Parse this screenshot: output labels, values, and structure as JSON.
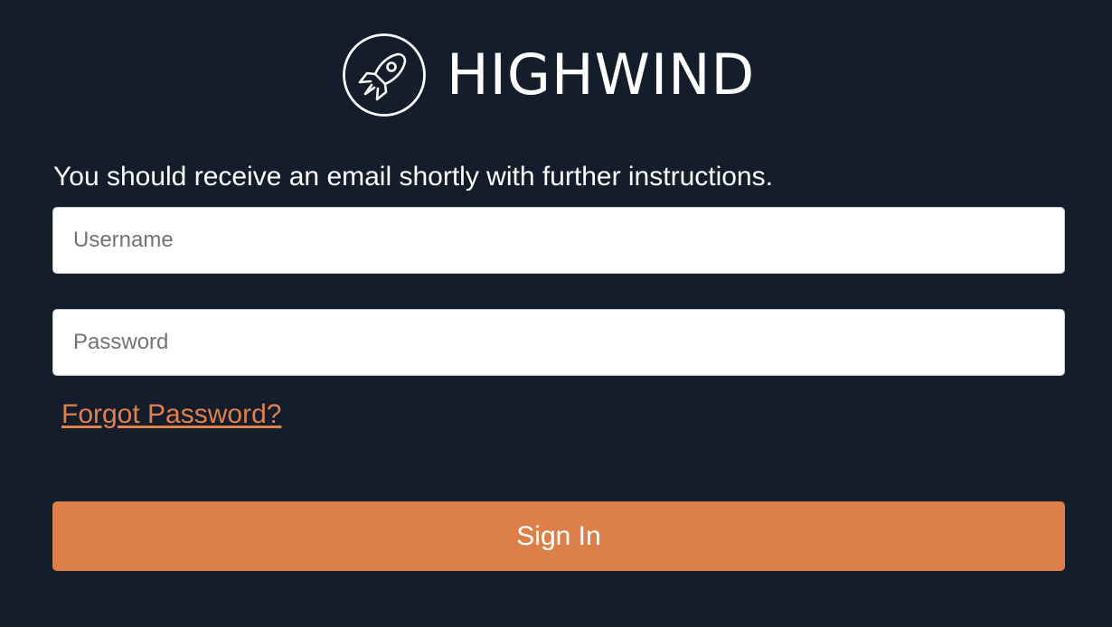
{
  "brand": {
    "name": "HIGHWIND",
    "logo_icon": "rocket-icon"
  },
  "login": {
    "message": "You should receive an email shortly with further instructions.",
    "username_placeholder": "Username",
    "password_placeholder": "Password",
    "forgot_link": "Forgot Password?",
    "signin_label": "Sign In"
  },
  "colors": {
    "background": "#131d2c",
    "accent": "#dd7f49",
    "link": "#e0804a",
    "text": "#ffffff"
  }
}
